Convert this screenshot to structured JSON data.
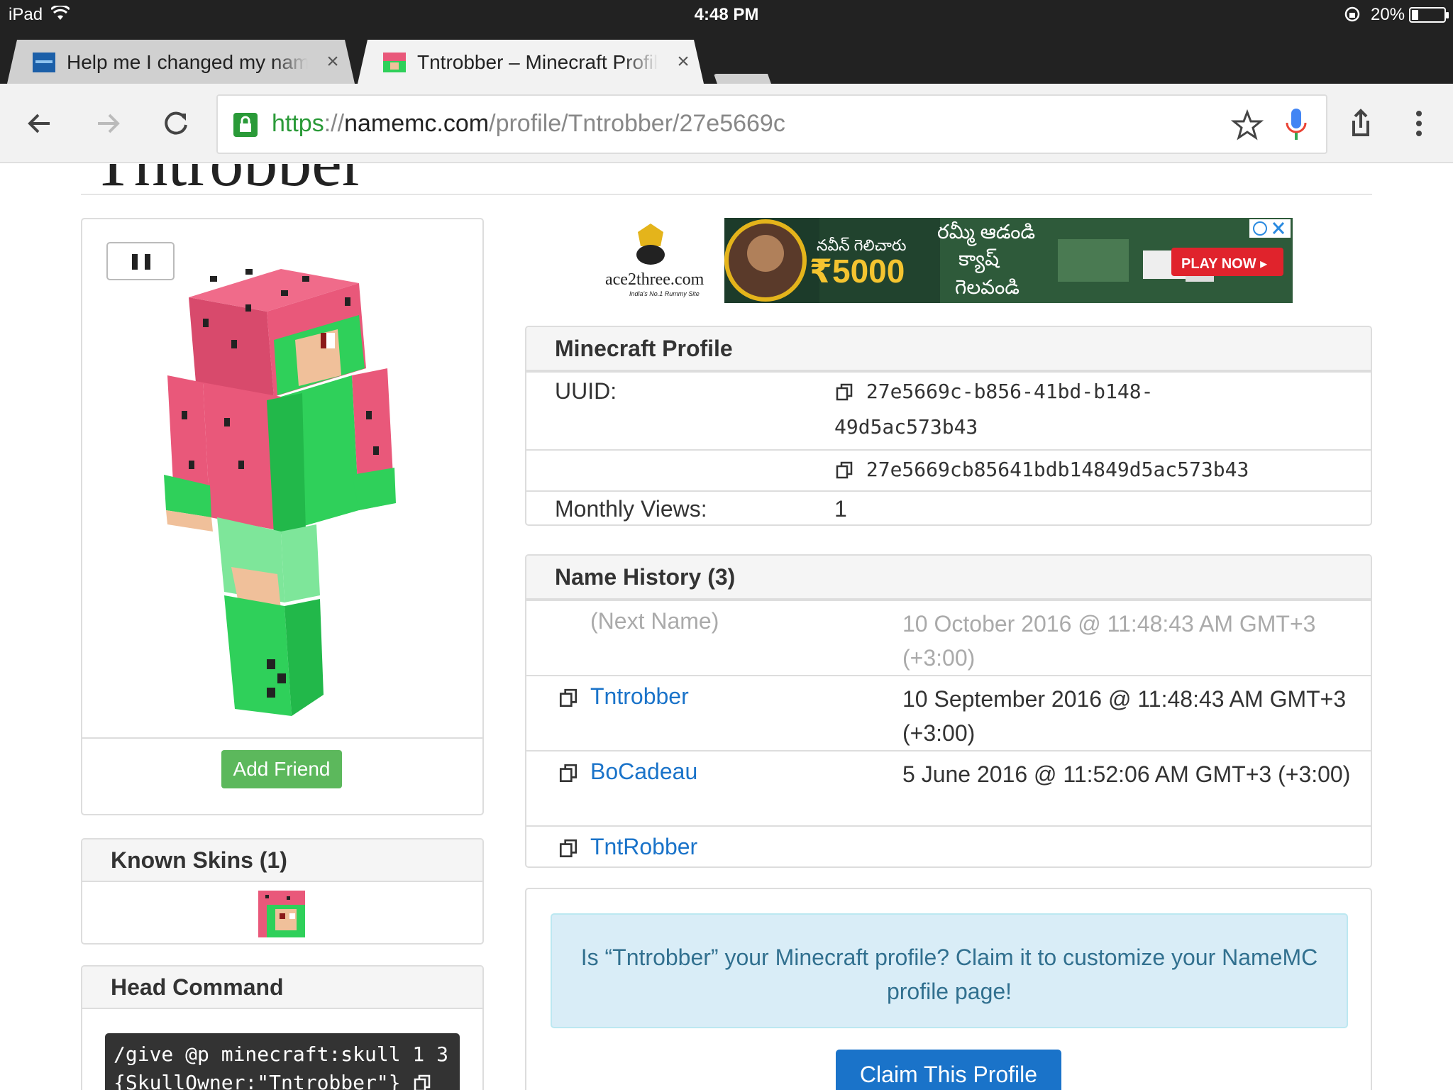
{
  "status_bar": {
    "device": "iPad",
    "time": "4:48 PM",
    "battery": "20%"
  },
  "tabs": [
    {
      "title": "Help me I changed my name",
      "close": "×"
    },
    {
      "title": "Tntrobber – Minecraft Profil",
      "close": "×"
    }
  ],
  "url": {
    "scheme": "https",
    "separator": "://",
    "host": "namemc.com",
    "path": "/profile/Tntrobber/27e5669c"
  },
  "page": {
    "title": "Tntrobber",
    "add_friend": "Add Friend",
    "known_skins": "Known Skins (1)",
    "head_command": {
      "title": "Head Command",
      "line1": "/give @p minecraft:skull 1 3",
      "line2": "{SkullOwner:\"Tntrobber\"}"
    }
  },
  "ad": {
    "brand": "ace2three.com",
    "tagline": "India's No.1 Rummy Site",
    "telugu_1": "నవీన్ గెలిచారు",
    "amount": "₹5000",
    "telugu_2": "రమ్మీ ఆడండి",
    "telugu_3": "క్యాష్",
    "telugu_4": "గెలవండి",
    "cta": "PLAY NOW ▸"
  },
  "profile": {
    "title": "Minecraft Profile",
    "uuid_label": "UUID:",
    "uuid_dashed": "27e5669c-b856-41bd-b148-49d5ac573b43",
    "uuid_plain": "27e5669cb85641bdb14849d5ac573b43",
    "views_label": "Monthly Views:",
    "views": "1"
  },
  "name_history": {
    "title": "Name History (3)",
    "rows": [
      {
        "name": "(Next Name)",
        "date": "10 October 2016 @ 11:48:43 AM GMT+3 (+3:00)"
      },
      {
        "name": "Tntrobber",
        "date": "10 September 2016 @ 11:48:43 AM GMT+3 (+3:00)"
      },
      {
        "name": "BoCadeau",
        "date": "5 June 2016 @ 11:52:06 AM GMT+3 (+3:00)"
      },
      {
        "name": "TntRobber",
        "date": ""
      }
    ]
  },
  "claim": {
    "message": "Is “Tntrobber” your Minecraft profile? Claim it to customize your NameMC profile page!",
    "button": "Claim This Profile"
  },
  "colors": {
    "link": "#1a73c9",
    "success": "#5cb85c",
    "secure": "#2a9a38",
    "info_bg": "#d9edf7"
  }
}
